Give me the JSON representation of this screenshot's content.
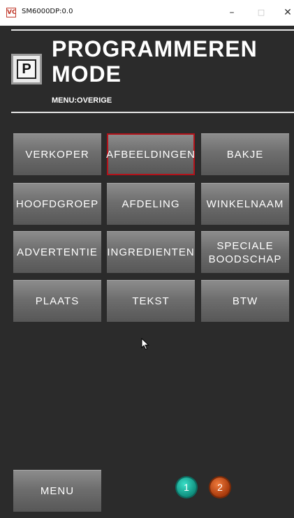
{
  "window": {
    "icon_text": "VC",
    "title": "SM6000DP:0.0",
    "minimize": "–",
    "maximize": "□",
    "close": "✕"
  },
  "header": {
    "logo_letter": "P",
    "title": "PROGRAMMEREN MODE",
    "subtitle": "MENU:OVERIGE"
  },
  "buttons": [
    {
      "label": "VERKOPER"
    },
    {
      "label": "AFBEELDINGEN",
      "selected": true
    },
    {
      "label": "BAKJE"
    },
    {
      "label": "HOOFDGROEP"
    },
    {
      "label": "AFDELING"
    },
    {
      "label": "WINKELNAAM"
    },
    {
      "label": "ADVERTENTIE"
    },
    {
      "label": "INGREDIENTEN"
    },
    {
      "label": "SPECIALE BOODSCHAP"
    },
    {
      "label": "PLAATS"
    },
    {
      "label": "TEKST"
    },
    {
      "label": "BTW"
    }
  ],
  "footer": {
    "menu_label": "MENU",
    "pages": [
      "1",
      "2"
    ],
    "active_page": "1"
  },
  "colors": {
    "background": "#2b2b2b",
    "selected_border": "#b3121a",
    "page1": "#13a893",
    "page2": "#d0501a"
  }
}
